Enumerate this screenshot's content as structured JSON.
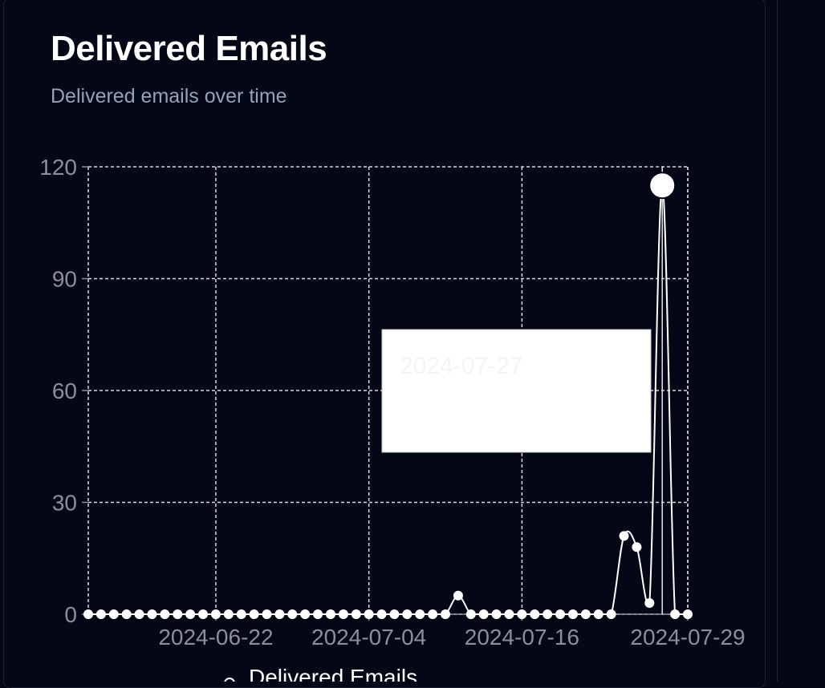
{
  "card": {
    "title": "Delivered Emails",
    "subtitle": "Delivered emails over time"
  },
  "colors": {
    "background": "#040816",
    "line": "#ffffff",
    "grid": "#d8d8d8",
    "tick_text": "#8a8f9c",
    "subtitle": "#94a3b8"
  },
  "chart_data": {
    "type": "line",
    "title": "",
    "xlabel": "",
    "ylabel": "",
    "ylim": [
      0,
      120
    ],
    "yticks": [
      0,
      30,
      60,
      90,
      120
    ],
    "xticks": [
      "2024-06-22",
      "2024-07-04",
      "2024-07-16",
      "2024-07-29"
    ],
    "x": [
      "2024-06-12",
      "2024-06-13",
      "2024-06-14",
      "2024-06-15",
      "2024-06-16",
      "2024-06-17",
      "2024-06-18",
      "2024-06-19",
      "2024-06-20",
      "2024-06-21",
      "2024-06-22",
      "2024-06-23",
      "2024-06-24",
      "2024-06-25",
      "2024-06-26",
      "2024-06-27",
      "2024-06-28",
      "2024-06-29",
      "2024-06-30",
      "2024-07-01",
      "2024-07-02",
      "2024-07-03",
      "2024-07-04",
      "2024-07-05",
      "2024-07-06",
      "2024-07-07",
      "2024-07-08",
      "2024-07-09",
      "2024-07-10",
      "2024-07-11",
      "2024-07-12",
      "2024-07-13",
      "2024-07-14",
      "2024-07-15",
      "2024-07-16",
      "2024-07-17",
      "2024-07-18",
      "2024-07-19",
      "2024-07-20",
      "2024-07-21",
      "2024-07-22",
      "2024-07-23",
      "2024-07-24",
      "2024-07-25",
      "2024-07-26",
      "2024-07-27",
      "2024-07-28",
      "2024-07-29"
    ],
    "series": [
      {
        "name": "Delivered Emails",
        "values": [
          0,
          0,
          0,
          0,
          0,
          0,
          0,
          0,
          0,
          0,
          0,
          0,
          0,
          0,
          0,
          0,
          0,
          0,
          0,
          0,
          0,
          0,
          0,
          0,
          0,
          0,
          0,
          0,
          0,
          5,
          0,
          0,
          0,
          0,
          0,
          0,
          0,
          0,
          0,
          0,
          0,
          0,
          21,
          18,
          3,
          115,
          0,
          0
        ]
      }
    ],
    "active_point": "2024-07-27",
    "tooltip": {
      "label": "2024-07-27"
    },
    "grid": true,
    "legend": "bottom"
  }
}
